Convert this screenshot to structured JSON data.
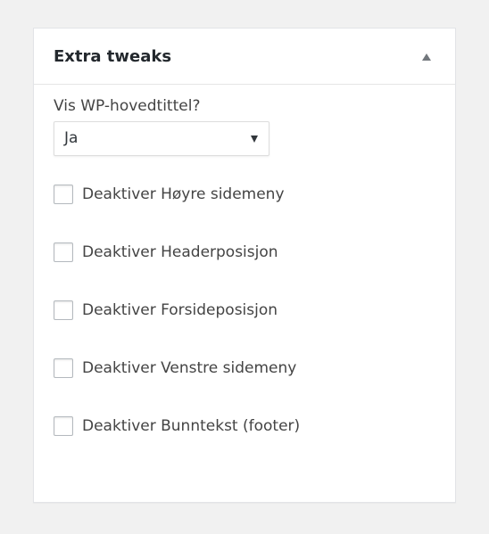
{
  "panel": {
    "title": "Extra tweaks",
    "toggle_icon": "triangle-up-icon"
  },
  "main_title_field": {
    "label": "Vis WP-hovedtittel?",
    "selected": "Ja"
  },
  "checkboxes": [
    {
      "label": "Deaktiver Høyre sidemeny",
      "checked": false
    },
    {
      "label": "Deaktiver Headerposisjon",
      "checked": false
    },
    {
      "label": "Deaktiver Forsideposisjon",
      "checked": false
    },
    {
      "label": "Deaktiver Venstre sidemeny",
      "checked": false
    },
    {
      "label": "Deaktiver Bunntekst (footer)",
      "checked": false
    }
  ],
  "colors": {
    "background": "#f1f1f1",
    "panel": "#ffffff",
    "text": "#23282d",
    "border": "#dddddd"
  }
}
